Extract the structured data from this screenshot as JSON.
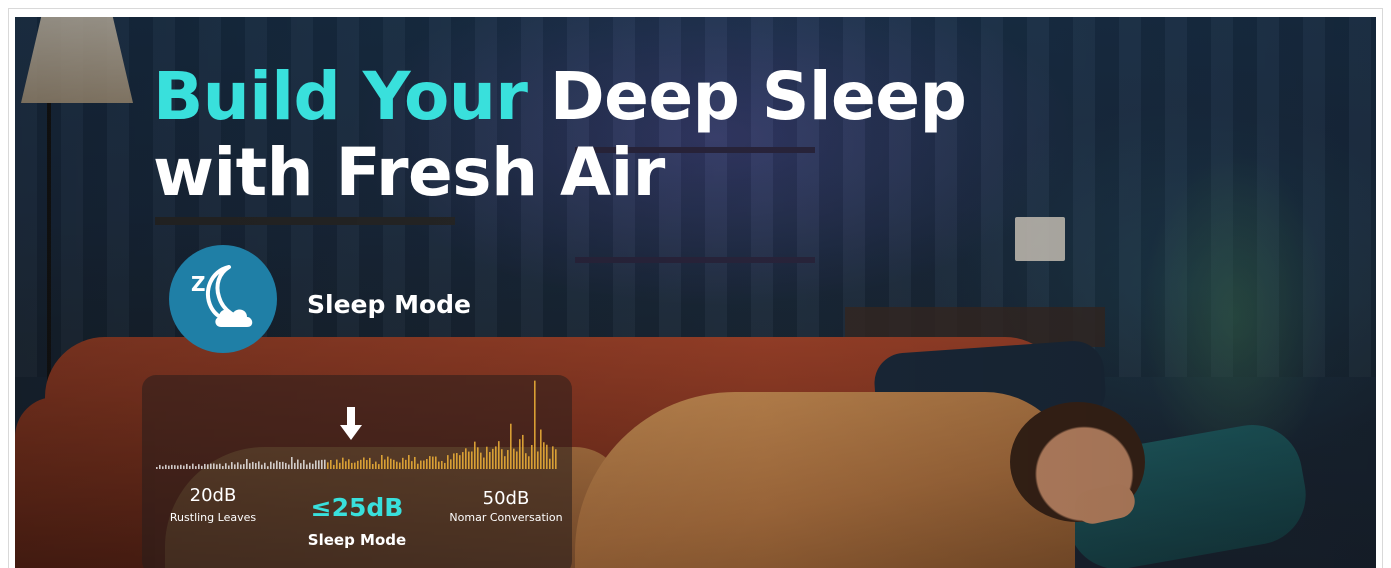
{
  "headline": {
    "accent_text": "Build Your",
    "line1_rest": " Deep Sleep",
    "line2": "with Fresh Air"
  },
  "badge": {
    "icon": "moon-cloud-zzz-icon",
    "icon_letter": "Z",
    "label": "Sleep Mode"
  },
  "noise_scale": {
    "low": {
      "value": "20dB",
      "caption": "Rustling Leaves"
    },
    "mid": {
      "value": "≤25dB",
      "caption": "Sleep Mode"
    },
    "high": {
      "value": "50dB",
      "caption": "Nomar Conversation"
    },
    "marker_icon": "down-arrow-icon"
  },
  "colors": {
    "accent": "#39e0dc",
    "badge_blue": "#1f7fa6",
    "bars_white": "#f2f2f2",
    "bars_amber": "#e0a536"
  }
}
